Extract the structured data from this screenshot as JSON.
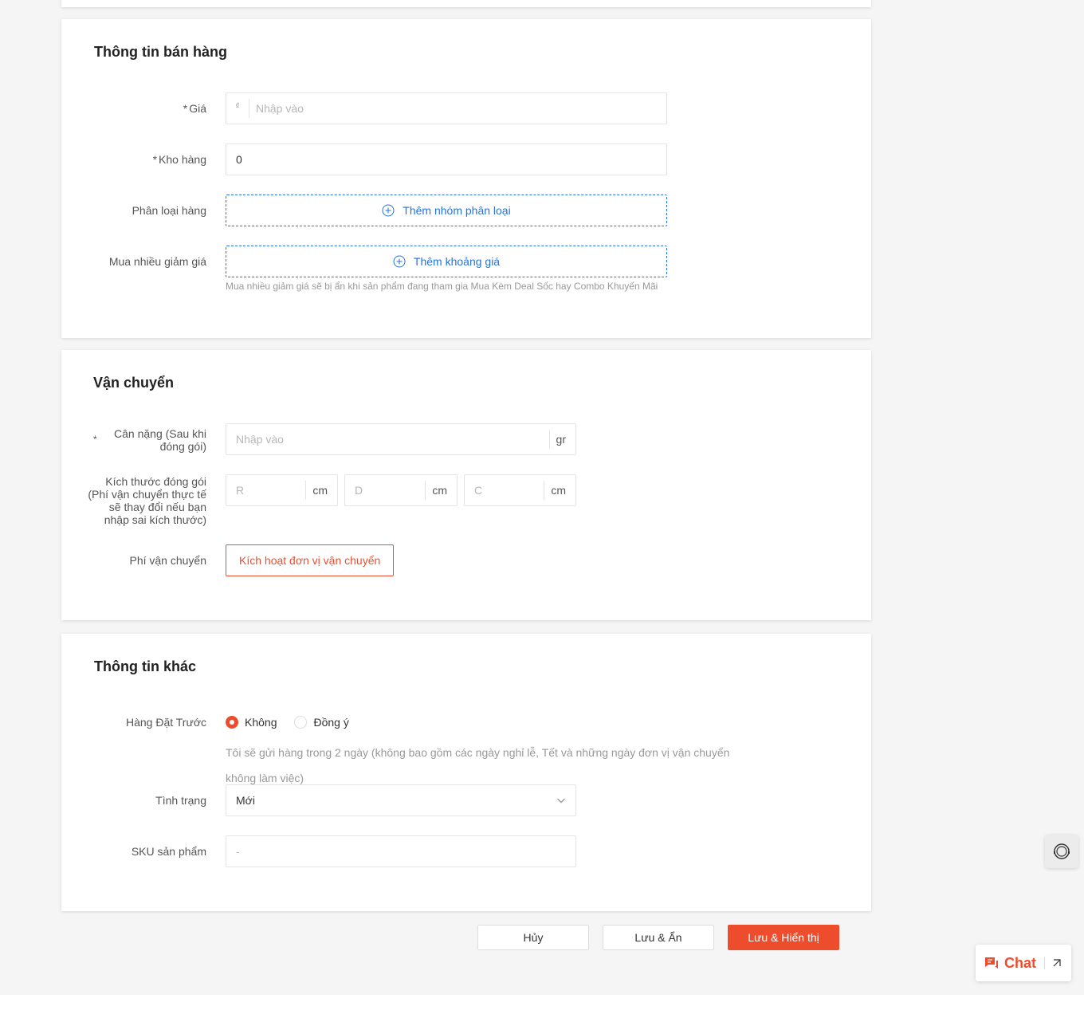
{
  "sales": {
    "title": "Thông tin bán hàng",
    "price_label": "Giá",
    "price_prefix": "₫",
    "price_placeholder": "Nhập vào",
    "stock_label": "Kho hàng",
    "stock_value": "0",
    "variation_label": "Phân loại hàng",
    "variation_button": "Thêm nhóm phân loại",
    "wholesale_label": "Mua nhiều giảm giá",
    "wholesale_button": "Thêm khoảng giá",
    "wholesale_hint": "Mua nhiều giảm giá sẽ bị ẩn khi sản phẩm đang tham gia Mua Kèm Deal Sốc hay Combo Khuyến Mãi"
  },
  "shipping": {
    "title": "Vận chuyển",
    "weight_label": "Cân nặng (Sau khi đóng gói)",
    "weight_placeholder": "Nhập vào",
    "weight_unit": "gr",
    "size_label": "Kích thước đóng gói (Phí vận chuyển thực tế sẽ thay đổi nếu bạn nhập sai kích thước)",
    "length_placeholder": "R",
    "width_placeholder": "D",
    "height_placeholder": "C",
    "size_unit": "cm",
    "fee_label": "Phí vận chuyển",
    "fee_button": "Kích hoạt đơn vị vận chuyển"
  },
  "other": {
    "title": "Thông tin khác",
    "preorder_label": "Hàng Đặt Trước",
    "preorder_options": [
      "Không",
      "Đồng ý"
    ],
    "preorder_selected": "Không",
    "preorder_desc": "Tôi sẽ gửi hàng trong 2 ngày (không bao gồm các ngày nghỉ lễ, Tết và những ngày đơn vị vận chuyển không làm việc)",
    "condition_label": "Tình trạng",
    "condition_value": "Mới",
    "sku_label": "SKU sản phẩm",
    "sku_placeholder": "-"
  },
  "actions": {
    "cancel": "Hủy",
    "save_hide": "Lưu & Ẩn",
    "save_show": "Lưu & Hiển thị"
  },
  "chat": {
    "label": "Chat"
  },
  "required_mark": "*",
  "colors": {
    "accent": "#ee4d2d",
    "link": "#2673dd"
  }
}
